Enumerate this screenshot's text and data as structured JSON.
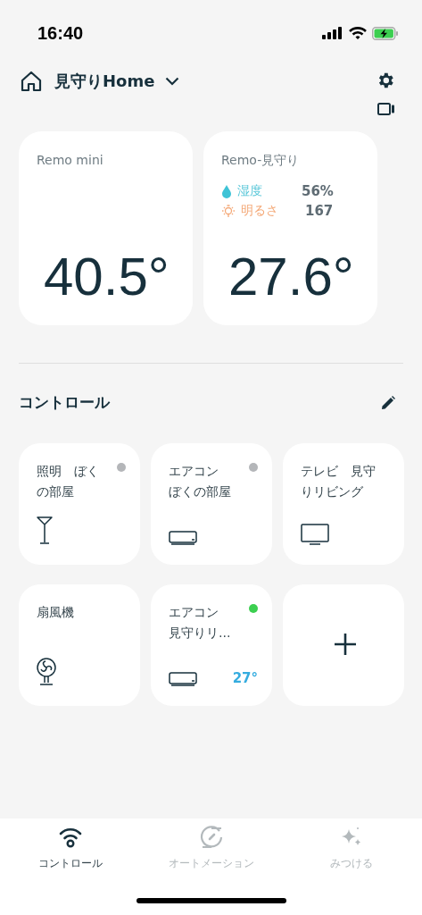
{
  "status_bar": {
    "time": "16:40"
  },
  "header": {
    "home_name": "見守りHome"
  },
  "sensors": [
    {
      "name": "Remo mini",
      "temperature": "40.5°"
    },
    {
      "name": "Remo-見守り",
      "temperature": "27.6°",
      "readings": [
        {
          "kind": "humidity",
          "label": "湿度",
          "value": "56%"
        },
        {
          "kind": "brightness",
          "label": "明るさ",
          "value": "167"
        }
      ]
    }
  ],
  "section": {
    "title": "コントロール"
  },
  "devices": [
    {
      "kind": "light",
      "name_lines": [
        "照明　ぼく",
        "の部屋"
      ],
      "color": "#b4b6b9"
    },
    {
      "kind": "aircon",
      "name_lines": [
        "エアコン",
        "ぼくの部屋"
      ],
      "color": "#b4b6b9"
    },
    {
      "kind": "tv",
      "name_lines": [
        "テレビ　見守",
        "りリビング"
      ]
    },
    {
      "kind": "fan",
      "name_lines": [
        "扇風機"
      ]
    },
    {
      "kind": "aircon",
      "name_lines": [
        "エアコン",
        "見守りリ…"
      ],
      "color": "#3ccf50",
      "setting": "27°"
    },
    {
      "kind": "add"
    }
  ],
  "tabs": [
    {
      "kind": "control",
      "label": "コントロール",
      "selected": true
    },
    {
      "kind": "automation",
      "label": "オートメーション",
      "selected": false
    },
    {
      "kind": "discover",
      "label": "みつける",
      "selected": false
    }
  ]
}
